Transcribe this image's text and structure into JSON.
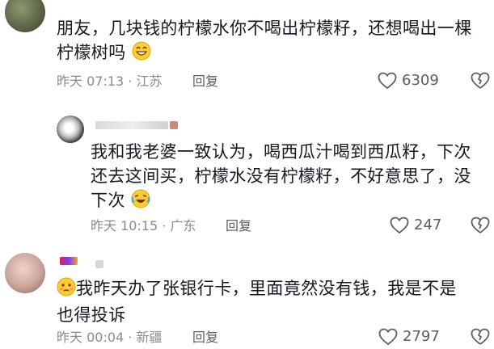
{
  "comments": [
    {
      "text_line1": "朋友，几块钱的柠檬水你不喝出柠檬籽，还想喝出一棵",
      "text_line2": "柠檬树吗",
      "emoji": "grin-emoji",
      "time": "昨天 07:13 · 江苏",
      "reply_label": "回复",
      "likes": "6309"
    },
    {
      "text_line1": "我和我老婆一致认为，喝西瓜汁喝到西瓜籽，下次",
      "text_line2": "还去这间买，柠檬水没有柠檬籽，不好意思了，没",
      "text_line3": "下次",
      "emoji": "laugh-cry-emoji",
      "time": "昨天 10:15 · 广东",
      "reply_label": "回复",
      "likes": "247"
    },
    {
      "text_line1": "我昨天办了张银行卡，里面竟然没有钱，我是不是",
      "text_line2": "也得投诉",
      "emoji": "embarrassed-emoji",
      "time": "昨天 00:04 · 新疆",
      "reply_label": "回复",
      "likes": "2797"
    }
  ],
  "colors": {
    "text": "#161823",
    "meta": "#8a8b91",
    "icon": "#5c5d63"
  }
}
